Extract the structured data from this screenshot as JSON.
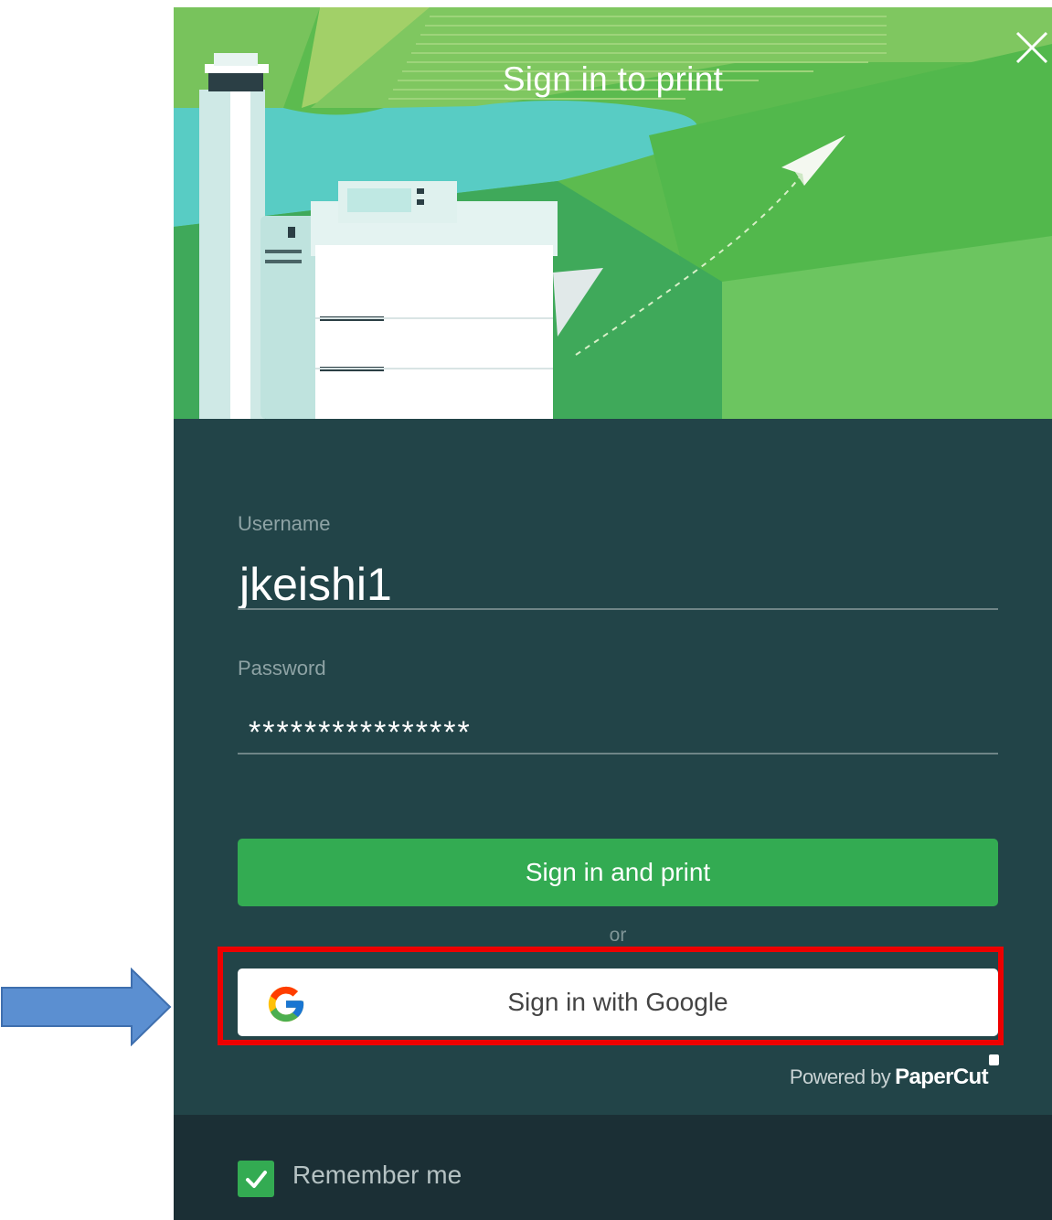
{
  "dialog": {
    "title": "Sign in to print",
    "close_icon": "close-icon"
  },
  "form": {
    "username_label": "Username",
    "username_value": "jkeishi1",
    "password_label": "Password",
    "password_value": "****************"
  },
  "actions": {
    "sign_in_label": "Sign in and print",
    "or_label": "or",
    "google_label": "Sign in with Google",
    "google_icon": "google-g-icon"
  },
  "branding": {
    "powered_prefix": "Powered by",
    "powered_brand": "PaperCut"
  },
  "footer": {
    "remember_label": "Remember me",
    "remember_checked": true
  },
  "colors": {
    "panel": "#224448",
    "footer": "#1b2f35",
    "primary_button": "#33ab52",
    "highlight": "#ee0000",
    "annotation_arrow": "#5b8fd1"
  }
}
